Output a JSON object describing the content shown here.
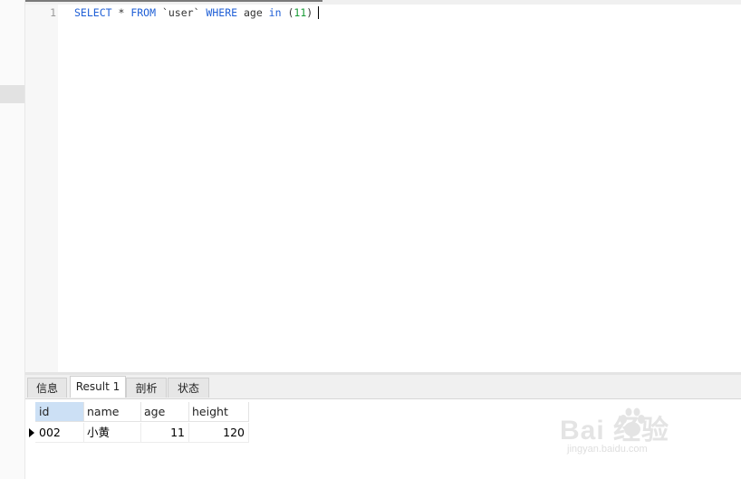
{
  "editor": {
    "line_number": "1",
    "sql": {
      "kw_select": "SELECT",
      "star": " * ",
      "kw_from": "FROM",
      "table": " `user` ",
      "kw_where": "WHERE",
      "column": " age ",
      "kw_in": "in",
      "open_paren": " (",
      "value": "11",
      "close_paren": ")"
    }
  },
  "result_tabs": [
    "信息",
    "Result 1",
    "剖析",
    "状态"
  ],
  "grid": {
    "columns": [
      "id",
      "name",
      "age",
      "height"
    ],
    "rows": [
      {
        "id": "002",
        "name": "小黄",
        "age": "11",
        "height": "120"
      }
    ]
  },
  "watermark": {
    "brand": "Bai  经验",
    "url": "jingyan.baidu.com"
  },
  "colors": {
    "keyword": "#1f5fd6",
    "number": "#1a9c38",
    "selected_header": "#cce0f5"
  }
}
